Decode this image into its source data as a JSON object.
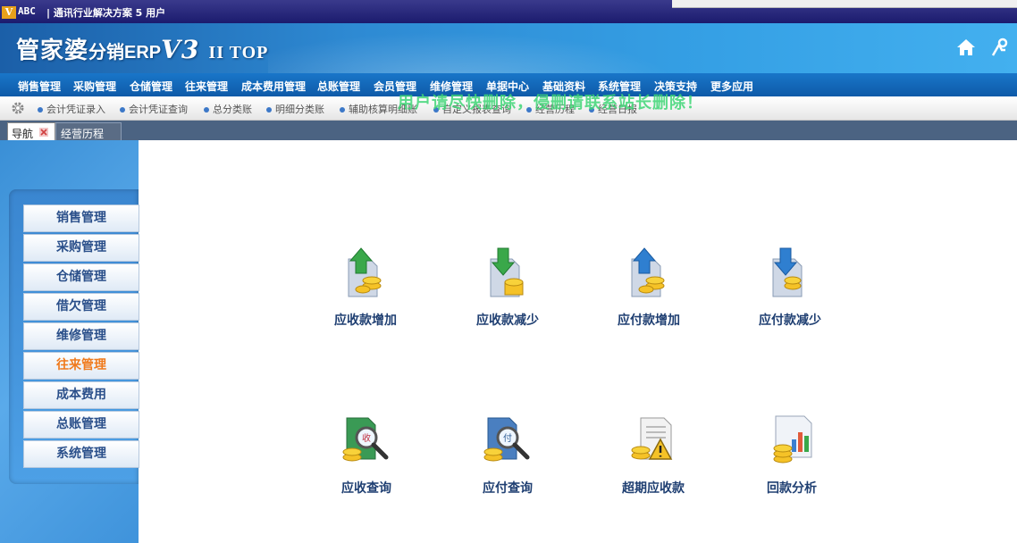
{
  "titlebar": {
    "logo": "V",
    "abc": "ABC",
    "caption": "| 通讯行业解决方案 5 用户"
  },
  "banner": {
    "brand_main": "管家婆",
    "brand_sub": "分销ERP",
    "brand_ver": "V3",
    "brand_top": "II TOP"
  },
  "menu": [
    "销售管理",
    "采购管理",
    "仓储管理",
    "往来管理",
    "成本费用管理",
    "总账管理",
    "会员管理",
    "维修管理",
    "单据中心",
    "基础资料",
    "系统管理",
    "决策支持",
    "更多应用"
  ],
  "submenu": [
    "会计凭证录入",
    "会计凭证查询",
    "总分类账",
    "明细分类账",
    "辅助核算明细账",
    "自定义报表查询",
    "经营历程",
    "经营日报"
  ],
  "watermark": "用户请尽快删除，侵删请联系站长删除！",
  "tabs": {
    "nav": "导航",
    "history": "经营历程"
  },
  "sidebar": [
    "销售管理",
    "采购管理",
    "仓储管理",
    "借欠管理",
    "维修管理",
    "往来管理",
    "成本费用",
    "总账管理",
    "系统管理"
  ],
  "sidebar_active": "往来管理",
  "tiles": {
    "receivable_increase": "应收款增加",
    "receivable_decrease": "应收款减少",
    "payable_increase": "应付款增加",
    "payable_decrease": "应付款减少",
    "receivable_query": "应收查询",
    "payable_query": "应付查询",
    "overdue_receivable": "超期应收款",
    "collection_analysis": "回款分析",
    "query_badge_receive": "收",
    "query_badge_pay": "付"
  },
  "colors": {
    "accent": "#1976c9",
    "active": "#f07a1c",
    "label": "#1f3f72"
  },
  "icons": [
    "home-icon",
    "person-icon",
    "gear-icon",
    "close-icon",
    "money-up-icon",
    "money-down-icon",
    "search-doc-icon",
    "warning-doc-icon",
    "chart-doc-icon"
  ]
}
